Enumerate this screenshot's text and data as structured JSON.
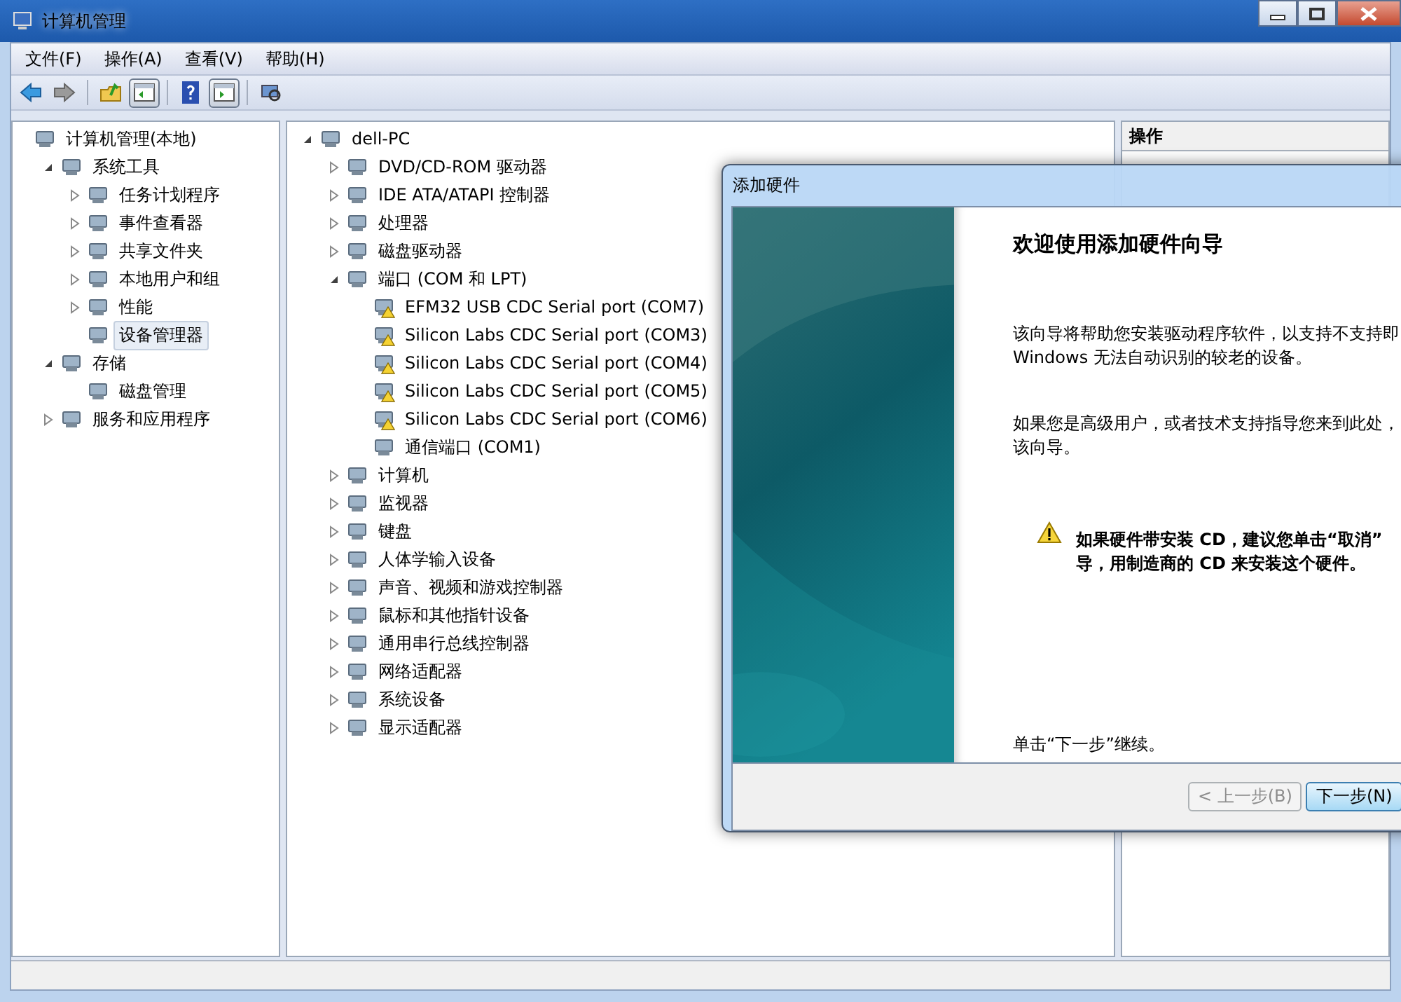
{
  "window": {
    "title": "计算机管理"
  },
  "menu": [
    "文件(F)",
    "操作(A)",
    "查看(V)",
    "帮助(H)"
  ],
  "toolbar": [
    {
      "kind": "back",
      "pressed": false
    },
    {
      "kind": "forward",
      "pressed": false
    },
    {
      "kind": "up",
      "pressed": false
    },
    {
      "kind": "console-tree",
      "pressed": true
    },
    {
      "kind": "help",
      "pressed": false
    },
    {
      "kind": "action-pane",
      "pressed": true
    },
    {
      "kind": "scan",
      "pressed": false
    }
  ],
  "console_tree": [
    {
      "label": "计算机管理(本地)",
      "selected": false,
      "children": [
        {
          "label": "系统工具",
          "selected": false,
          "expanded": true,
          "children": [
            {
              "label": "任务计划程序",
              "selected": false,
              "expanded": false
            },
            {
              "label": "事件查看器",
              "selected": false,
              "expanded": false
            },
            {
              "label": "共享文件夹",
              "selected": false,
              "expanded": false
            },
            {
              "label": "本地用户和组",
              "selected": false,
              "expanded": false
            },
            {
              "label": "性能",
              "selected": false,
              "expanded": false
            },
            {
              "label": "设备管理器",
              "selected": true
            }
          ]
        },
        {
          "label": "存储",
          "selected": false,
          "expanded": true,
          "children": [
            {
              "label": "磁盘管理",
              "selected": false
            }
          ]
        },
        {
          "label": "服务和应用程序",
          "selected": false,
          "expanded": false
        }
      ]
    }
  ],
  "device_tree": [
    {
      "label": "dell-PC",
      "expanded": true,
      "children": [
        {
          "label": "DVD/CD-ROM 驱动器",
          "expanded": false
        },
        {
          "label": "IDE ATA/ATAPI 控制器",
          "expanded": false
        },
        {
          "label": "处理器",
          "expanded": false
        },
        {
          "label": "磁盘驱动器",
          "expanded": false
        },
        {
          "label": "端口 (COM 和 LPT)",
          "expanded": true,
          "children": [
            {
              "label": "EFM32 USB CDC Serial port (COM7)",
              "warning": true
            },
            {
              "label": "Silicon Labs CDC Serial port (COM3)",
              "warning": true
            },
            {
              "label": "Silicon Labs CDC Serial port (COM4)",
              "warning": true
            },
            {
              "label": "Silicon Labs CDC Serial port (COM5)",
              "warning": true
            },
            {
              "label": "Silicon Labs CDC Serial port (COM6)",
              "warning": true
            },
            {
              "label": "通信端口 (COM1)",
              "warning": false
            }
          ]
        },
        {
          "label": "计算机",
          "expanded": false
        },
        {
          "label": "监视器",
          "expanded": false
        },
        {
          "label": "键盘",
          "expanded": false
        },
        {
          "label": "人体学输入设备",
          "expanded": false
        },
        {
          "label": "声音、视频和游戏控制器",
          "expanded": false
        },
        {
          "label": "鼠标和其他指针设备",
          "expanded": false
        },
        {
          "label": "通用串行总线控制器",
          "expanded": false
        },
        {
          "label": "网络适配器",
          "expanded": false
        },
        {
          "label": "系统设备",
          "expanded": false
        },
        {
          "label": "显示适配器",
          "expanded": false
        }
      ]
    }
  ],
  "actions": {
    "heading": "操作"
  },
  "dialog": {
    "title": "添加硬件",
    "heading": "欢迎使用添加硬件向导",
    "paragraphs": [
      [
        "该向导将帮助您安装驱动程序软件，以支持不支持即",
        "Windows 无法自动识别的较老的设备。"
      ],
      [
        "如果您是高级用户，或者技术支持指导您来到此处，",
        "该向导。"
      ]
    ],
    "warning": [
      "如果硬件带安装 CD，建议您单击“取消”",
      "导，用制造商的 CD 来安装这个硬件。"
    ],
    "footer_note": "单击“下一步”继续。",
    "buttons": [
      {
        "label": "< 上一步(B)",
        "disabled": true,
        "default": false
      },
      {
        "label": "下一步(N)",
        "disabled": false,
        "default": true
      }
    ]
  }
}
